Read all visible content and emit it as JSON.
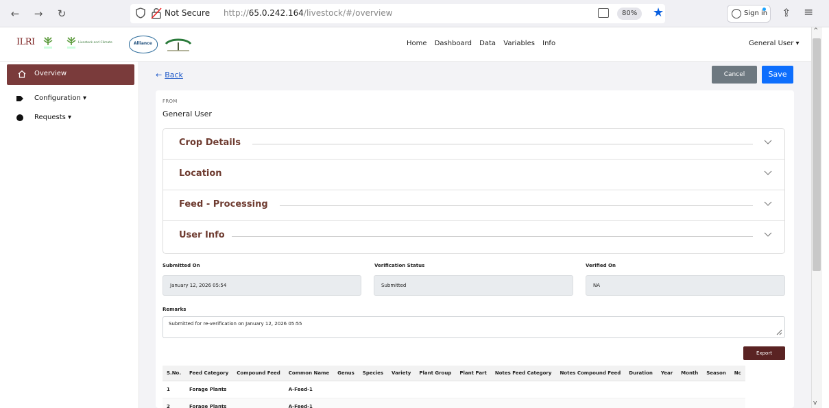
{
  "browser": {
    "not_secure": "Not Secure",
    "url_prefix": "http://",
    "url_host": "65.0.242.164",
    "url_path": "/livestock/#/overview",
    "zoom": "80%",
    "sign_in": "Sign in"
  },
  "header": {
    "logo_text": "ILRI",
    "logo_partner_text": "Livestock and Climate",
    "logo_alliance_text": "Alliance",
    "nav": [
      "Home",
      "Dashboard",
      "Data",
      "Variables",
      "Info"
    ],
    "user_menu": "General User ▾"
  },
  "sidebar": {
    "items": [
      {
        "label": "Overview",
        "icon": "home-icon"
      },
      {
        "label": "Configuration ▾",
        "icon": "tag-icon"
      },
      {
        "label": "Requests ▾",
        "icon": "location-pin-icon"
      }
    ]
  },
  "toolbar": {
    "back_label": "Back",
    "cancel_label": "Cancel",
    "save_label": "Save"
  },
  "form": {
    "from_label": "FROM",
    "from_value": "General User",
    "sections": [
      "Crop Details",
      "Location",
      "Feed - Processing",
      "User Info"
    ],
    "submitted_on_label": "Submitted On",
    "submitted_on_value": "January 12, 2026 05:54",
    "verification_status_label": "Verification Status",
    "verification_status_value": "Submitted",
    "verified_on_label": "Verified On",
    "verified_on_value": "NA",
    "remarks_label": "Remarks",
    "remarks_value": "Submitted for re-verification on January 12, 2026 05:55",
    "export_label": "Export"
  },
  "table": {
    "columns": [
      "S.No.",
      "Feed Category",
      "Compound Feed",
      "Common Name",
      "Genus",
      "Species",
      "Variety",
      "Plant Group",
      "Plant Part",
      "Notes Feed Category",
      "Notes Compound Feed",
      "Duration",
      "Year",
      "Month",
      "Season",
      "Nc"
    ],
    "rows": [
      [
        "1",
        "Forage Plants",
        "",
        "A-Feed-1",
        "",
        "",
        "",
        "",
        "",
        "",
        "",
        "",
        "",
        "",
        "",
        ""
      ],
      [
        "2",
        "Forage Plants",
        "",
        "A-Feed-1",
        "",
        "",
        "",
        "",
        "",
        "",
        "",
        "",
        "",
        "",
        "",
        ""
      ]
    ]
  },
  "colors": {
    "accent_brown": "#7a3b3b",
    "section_title": "#6e3b30",
    "save_blue": "#0d6efd",
    "cancel_gray": "#6d7880",
    "export_brown": "#5a2323"
  }
}
